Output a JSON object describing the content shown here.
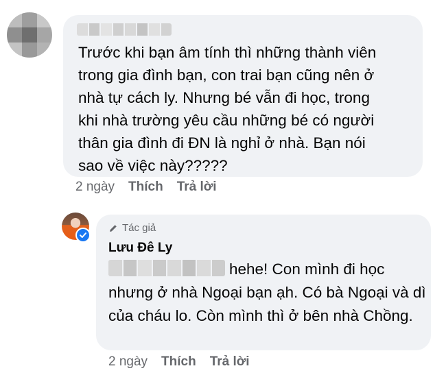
{
  "comment": {
    "text": "Trước khi bạn âm tính thì những thành viên\ntrong gia đình bạn, con trai bạn cũng nên ở\nnhà tự cách ly. Nhưng bé vẫn đi học, trong\nkhi nhà trường yêu cầu những bé có người\nthân gia đình đi ĐN là nghỉ ở nhà. Bạn nói\nsao về việc này?????",
    "time": "2 ngày",
    "like_label": "Thích",
    "reply_label": "Trả lời"
  },
  "reply": {
    "author_tag": "Tác giả",
    "author_name": "Lưu Đê Ly",
    "first_line": "hehe! Con mình đi học",
    "rest": "nhưng ở nhà Ngoại bạn ạh. Có bà Ngoại và dì của cháu lo. Còn mình thì ở bên nhà Chồng.",
    "time": "2 ngày",
    "like_label": "Thích",
    "reply_label": "Trả lời"
  },
  "colors": {
    "bubble": "#f0f2f5",
    "meta": "#65676b",
    "verified": "#1877f2"
  },
  "icons": [
    "pencil-icon",
    "verified-badge-icon"
  ]
}
